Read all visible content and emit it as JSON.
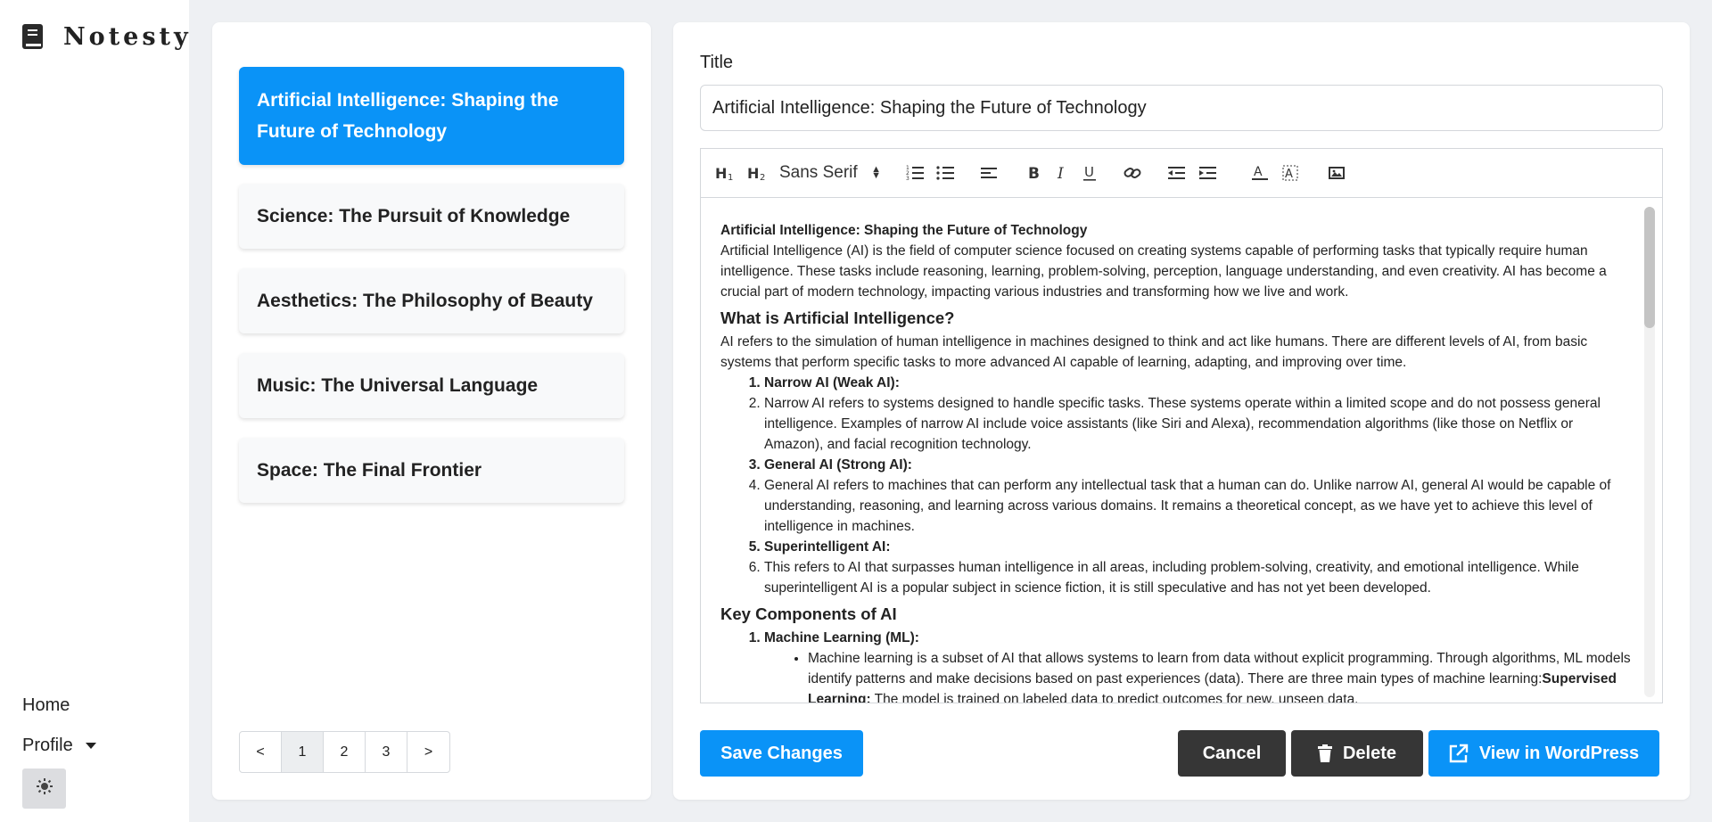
{
  "app": {
    "name": "Notesty"
  },
  "sidebar": {
    "home": "Home",
    "profile": "Profile"
  },
  "notes": [
    {
      "title": "Artificial Intelligence: Shaping the Future of Technology",
      "active": true
    },
    {
      "title": "Science: The Pursuit of Knowledge"
    },
    {
      "title": "Aesthetics: The Philosophy of Beauty"
    },
    {
      "title": "Music: The Universal Language"
    },
    {
      "title": "Space: The Final Frontier"
    }
  ],
  "pagination": {
    "prev": "<",
    "pages": [
      "1",
      "2",
      "3"
    ],
    "next": ">",
    "current": "1"
  },
  "editor": {
    "title_label": "Title",
    "title_value": "Artificial Intelligence: Shaping the Future of Technology",
    "font_select": "Sans Serif",
    "toolbar_icons": [
      "heading-1-icon",
      "heading-2-icon",
      "ordered-list-icon",
      "bullet-list-icon",
      "align-icon",
      "bold-icon",
      "italic-icon",
      "underline-icon",
      "link-icon",
      "outdent-icon",
      "indent-icon",
      "text-color-icon",
      "background-color-icon",
      "image-icon"
    ],
    "content": {
      "heading": "Artificial Intelligence: Shaping the Future of Technology",
      "intro": "Artificial Intelligence (AI) is the field of computer science focused on creating systems capable of performing tasks that typically require human intelligence. These tasks include reasoning, learning, problem-solving, perception, language understanding, and even creativity. AI has become a crucial part of modern technology, impacting various industries and transforming how we live and work.",
      "section1_title": "What is Artificial Intelligence?",
      "section1_text": "AI refers to the simulation of human intelligence in machines designed to think and act like humans. There are different levels of AI, from basic systems that perform specific tasks to more advanced AI capable of learning, adapting, and improving over time.",
      "list1": [
        {
          "text": "Narrow AI (Weak AI):",
          "bold": true
        },
        {
          "text": "Narrow AI refers to systems designed to handle specific tasks. These systems operate within a limited scope and do not possess general intelligence. Examples of narrow AI include voice assistants (like Siri and Alexa), recommendation algorithms (like those on Netflix or Amazon), and facial recognition technology."
        },
        {
          "text": "General AI (Strong AI):",
          "bold": true
        },
        {
          "text": "General AI refers to machines that can perform any intellectual task that a human can do. Unlike narrow AI, general AI would be capable of understanding, reasoning, and learning across various domains. It remains a theoretical concept, as we have yet to achieve this level of intelligence in machines."
        },
        {
          "text": "Superintelligent AI:",
          "bold": true
        },
        {
          "text": "This refers to AI that surpasses human intelligence in all areas, including problem-solving, creativity, and emotional intelligence. While superintelligent AI is a popular subject in science fiction, it is still speculative and has not yet been developed."
        }
      ],
      "section2_title": "Key Components of AI",
      "list2_item": "Machine Learning (ML):",
      "ml_text": "Machine learning is a subset of AI that allows systems to learn from data without explicit programming. Through algorithms, ML models identify patterns and make decisions based on past experiences (data). There are three main types of machine learning:",
      "ml_bold": "Supervised Learning:",
      "ml_tail": " The model is trained on labeled data to predict outcomes for new, unseen data."
    }
  },
  "actions": {
    "save": "Save Changes",
    "cancel": "Cancel",
    "delete": "Delete",
    "wordpress": "View in WordPress"
  },
  "colors": {
    "accent": "#0a93f7",
    "dark_button": "#363636",
    "background": "#eef0f3"
  }
}
